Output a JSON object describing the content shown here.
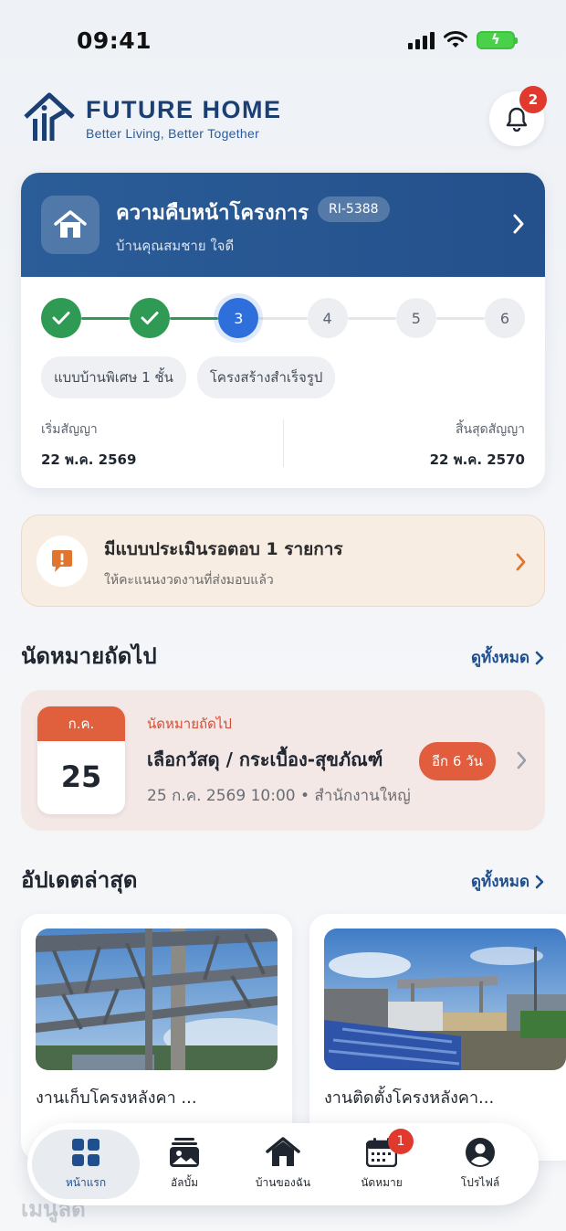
{
  "status_bar": {
    "time": "09:41"
  },
  "brand": {
    "name": "FUTURE HOME",
    "tagline": "Better Living, Better Together"
  },
  "notifications": {
    "badge": "2"
  },
  "project": {
    "title": "ความคืบหน้าโครงการ",
    "code": "RI-5388",
    "owner": "บ้านคุณสมชาย ใจดี",
    "steps": [
      {
        "label": "",
        "state": "done"
      },
      {
        "label": "",
        "state": "done"
      },
      {
        "label": "3",
        "state": "current"
      },
      {
        "label": "4",
        "state": "todo"
      },
      {
        "label": "5",
        "state": "todo"
      },
      {
        "label": "6",
        "state": "todo"
      }
    ],
    "tags": [
      "แบบบ้านพิเศษ 1 ชั้น",
      "โครงสร้างสำเร็จรูป"
    ],
    "start_label": "เริ่มสัญญา",
    "start_date": "22 พ.ค. 2569",
    "end_label": "สิ้นสุดสัญญา",
    "end_date": "22 พ.ค. 2570"
  },
  "review": {
    "title": "มีแบบประเมินรอตอบ 1 รายการ",
    "subtitle": "ให้คะแนนงวดงานที่ส่งมอบแล้ว"
  },
  "appointments_section": {
    "title": "นัดหมายถัดไป",
    "see_all": "ดูทั้งหมด"
  },
  "appointment": {
    "month": "ก.ค.",
    "day": "25",
    "kicker": "นัดหมายถัดไป",
    "title": "เลือกวัสดุ / กระเบื้อง-สุขภัณฑ์",
    "meta": "25 ก.ค. 2569 10:00 • สำนักงานใหญ่",
    "countdown": "อีก 6 วัน"
  },
  "updates_section": {
    "title": "อัปเดตล่าสุด",
    "see_all": "ดูทั้งหมด"
  },
  "updates": [
    {
      "caption": "งานเก็บโครงหลังคา ..."
    },
    {
      "caption": "งานติดตั้งโครงหลังคา..."
    }
  ],
  "menu_section": {
    "title": "เมนูลัด"
  },
  "nav": {
    "items": [
      {
        "label": "หน้าแรก",
        "icon": "home-grid-icon",
        "active": true
      },
      {
        "label": "อัลบั้ม",
        "icon": "album-icon"
      },
      {
        "label": "บ้านของฉัน",
        "icon": "house-icon"
      },
      {
        "label": "นัดหมาย",
        "icon": "calendar-icon",
        "badge": "1"
      },
      {
        "label": "โปรไฟล์",
        "icon": "profile-icon"
      }
    ]
  },
  "colors": {
    "brand_blue": "#24508b",
    "step_done": "#2e9a54",
    "step_current": "#2f6fdb",
    "accent_orange": "#e15d3e",
    "badge_red": "#e03a2f"
  }
}
